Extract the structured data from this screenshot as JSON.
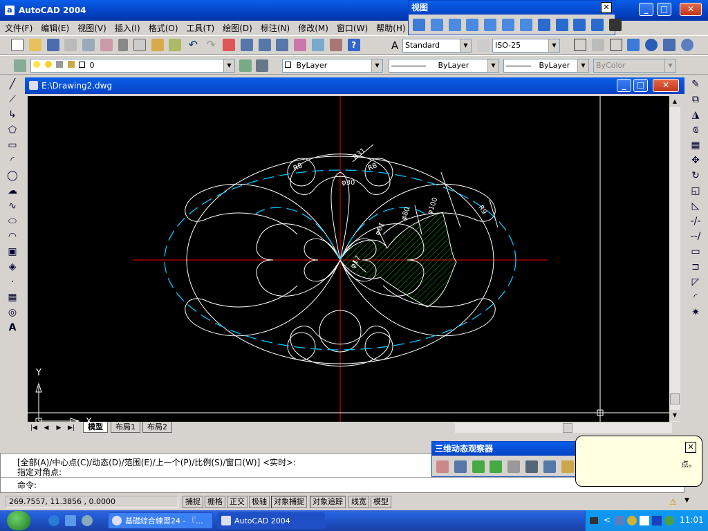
{
  "app": {
    "title": "AutoCAD 2004",
    "icon_letter": "a"
  },
  "window_controls": {
    "minimize": "_",
    "maximize": "□",
    "close": "✕"
  },
  "menu": [
    "文件(F)",
    "编辑(E)",
    "视图(V)",
    "插入(I)",
    "格式(O)",
    "工具(T)",
    "绘图(D)",
    "标注(N)",
    "修改(M)",
    "窗口(W)",
    "帮助(H)"
  ],
  "toolbar_styles": {
    "text_style": "Standard",
    "dim_style": "ISO-25"
  },
  "layer_toolbar": {
    "layer_value": "0",
    "color": "ByLayer",
    "linetype": "ByLayer",
    "lineweight": "ByLayer",
    "plotstyle": "ByColor"
  },
  "document": {
    "title": "E:\\Drawing2.dwg"
  },
  "ucs": {
    "y_label": "Y",
    "x_label": "X"
  },
  "dimensions": [
    "R8",
    "R31",
    "R8",
    "φ30",
    "R9",
    "φ100",
    "φ80",
    "φ61",
    "φ17"
  ],
  "layout_tabs": [
    "模型",
    "布局1",
    "布局2"
  ],
  "command": {
    "line1": "[全部(A)/中心点(C)/动态(D)/范围(E)/上一个(P)/比例(S)/窗口(W)] <实时>:",
    "line2": "指定对角点:",
    "line3": "命令:"
  },
  "status": {
    "coords": "269.7557, 11.3856 , 0.0000",
    "buttons": [
      "捕捉",
      "栅格",
      "正交",
      "极轴",
      "对象捕捉",
      "对象追踪",
      "线宽",
      "模型"
    ]
  },
  "panels": {
    "view": "视图",
    "orbit": "三维动态观察器"
  },
  "balloon": {
    "text": "点。"
  },
  "taskbar": {
    "tasks": [
      "基礎綜合練習24 - 『...",
      "AutoCAD 2004"
    ],
    "clock": "11:01"
  },
  "colors": {
    "canvas": "#000000",
    "geometry": "#ffffff",
    "centerline": "#ff0000",
    "cyan": "#00c8ff",
    "hatch": "#00b000",
    "titlebar": "#0343c4"
  }
}
